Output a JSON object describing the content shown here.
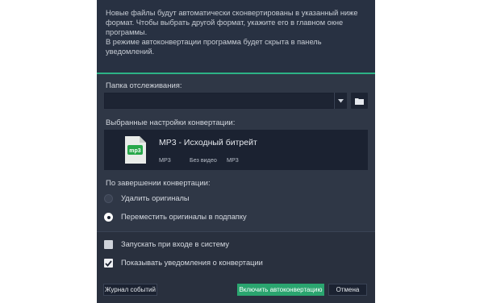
{
  "info": {
    "paragraph1": "Новые файлы будут автоматически сконвертированы в указанный ниже формат. Чтобы выбрать другой формат, укажите его в главном окне программы.",
    "paragraph2": "В режиме автоконвертации программа будет скрыта в панель уведомлений."
  },
  "watch_folder": {
    "label": "Папка отслеживания:",
    "value": ""
  },
  "preset": {
    "label": "Выбранные настройки конвертации:",
    "title": "MP3 - Исходный битрейт",
    "icon_text": "mp3",
    "meta": [
      "MP3",
      "Без видео",
      "MP3"
    ]
  },
  "after": {
    "label": "По завершении конвертации:",
    "options": [
      {
        "label": "Удалить оригиналы",
        "selected": false
      },
      {
        "label": "Переместить оригиналы в подпапку",
        "selected": true
      }
    ]
  },
  "checks": [
    {
      "label": "Запускать при входе в систему",
      "checked": false
    },
    {
      "label": "Показывать уведомления о конвертации",
      "checked": true
    }
  ],
  "buttons": {
    "log": "Журнал событий",
    "enable": "Включить автоконвертацию",
    "cancel": "Отмена"
  },
  "colors": {
    "dialog_bg": "#2f3746",
    "accent_green": "#2aa56f",
    "field_bg": "#1d2433"
  }
}
